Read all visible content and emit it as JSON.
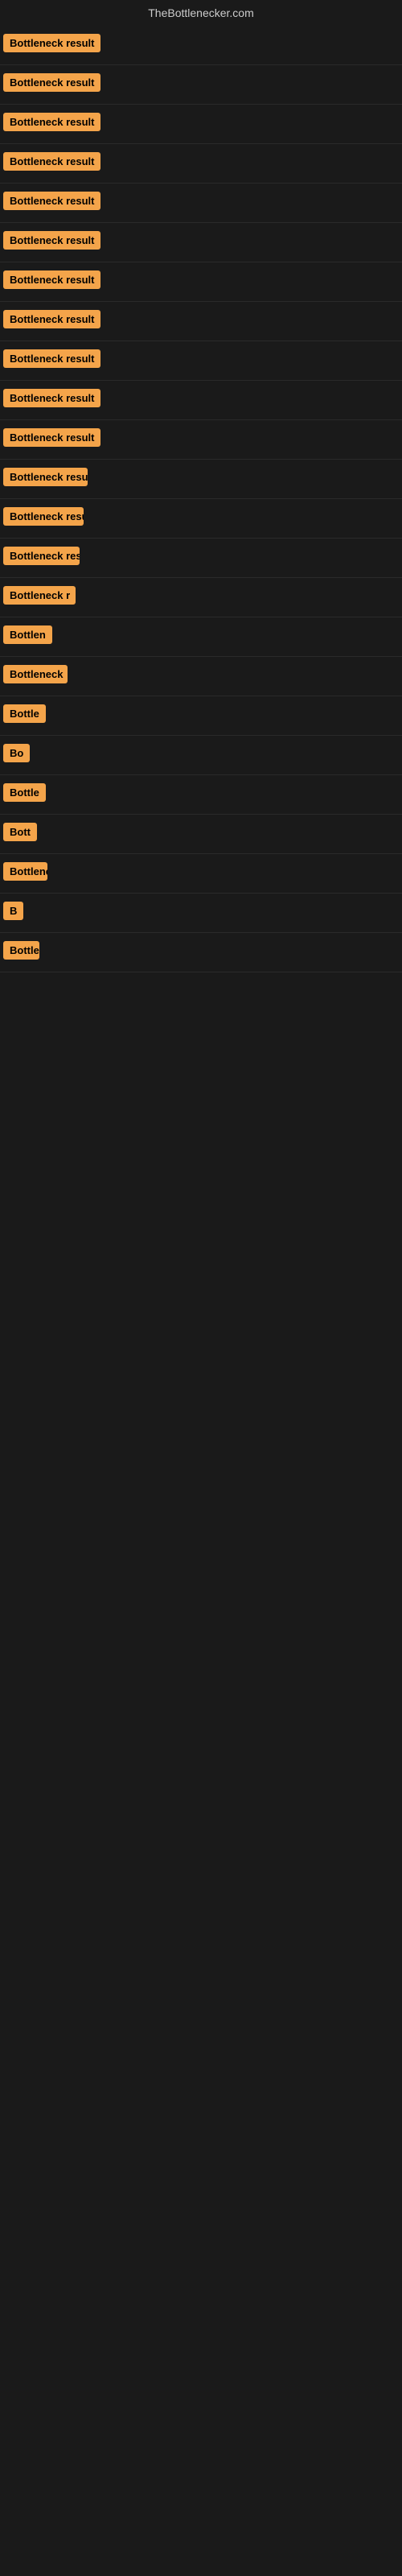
{
  "site": {
    "title": "TheBottlenecker.com"
  },
  "rows": [
    {
      "id": 1,
      "label": "Bottleneck result",
      "clip": false
    },
    {
      "id": 2,
      "label": "Bottleneck result",
      "clip": false
    },
    {
      "id": 3,
      "label": "Bottleneck result",
      "clip": false
    },
    {
      "id": 4,
      "label": "Bottleneck result",
      "clip": false
    },
    {
      "id": 5,
      "label": "Bottleneck result",
      "clip": false
    },
    {
      "id": 6,
      "label": "Bottleneck result",
      "clip": false
    },
    {
      "id": 7,
      "label": "Bottleneck result",
      "clip": false
    },
    {
      "id": 8,
      "label": "Bottleneck result",
      "clip": false
    },
    {
      "id": 9,
      "label": "Bottleneck result",
      "clip": false
    },
    {
      "id": 10,
      "label": "Bottleneck result",
      "clip": false
    },
    {
      "id": 11,
      "label": "Bottleneck result",
      "clip": false
    },
    {
      "id": 12,
      "label": "Bottleneck resu",
      "clip": true
    },
    {
      "id": 13,
      "label": "Bottleneck result",
      "clip": true
    },
    {
      "id": 14,
      "label": "Bottleneck resul",
      "clip": true
    },
    {
      "id": 15,
      "label": "Bottleneck r",
      "clip": true
    },
    {
      "id": 16,
      "label": "Bottlen",
      "clip": true
    },
    {
      "id": 17,
      "label": "Bottleneck",
      "clip": true
    },
    {
      "id": 18,
      "label": "Bottle",
      "clip": true
    },
    {
      "id": 19,
      "label": "Bo",
      "clip": true
    },
    {
      "id": 20,
      "label": "Bottle",
      "clip": true
    },
    {
      "id": 21,
      "label": "Bott",
      "clip": true
    },
    {
      "id": 22,
      "label": "Bottlene",
      "clip": true
    },
    {
      "id": 23,
      "label": "B",
      "clip": true
    },
    {
      "id": 24,
      "label": "Bottle",
      "clip": true
    }
  ]
}
